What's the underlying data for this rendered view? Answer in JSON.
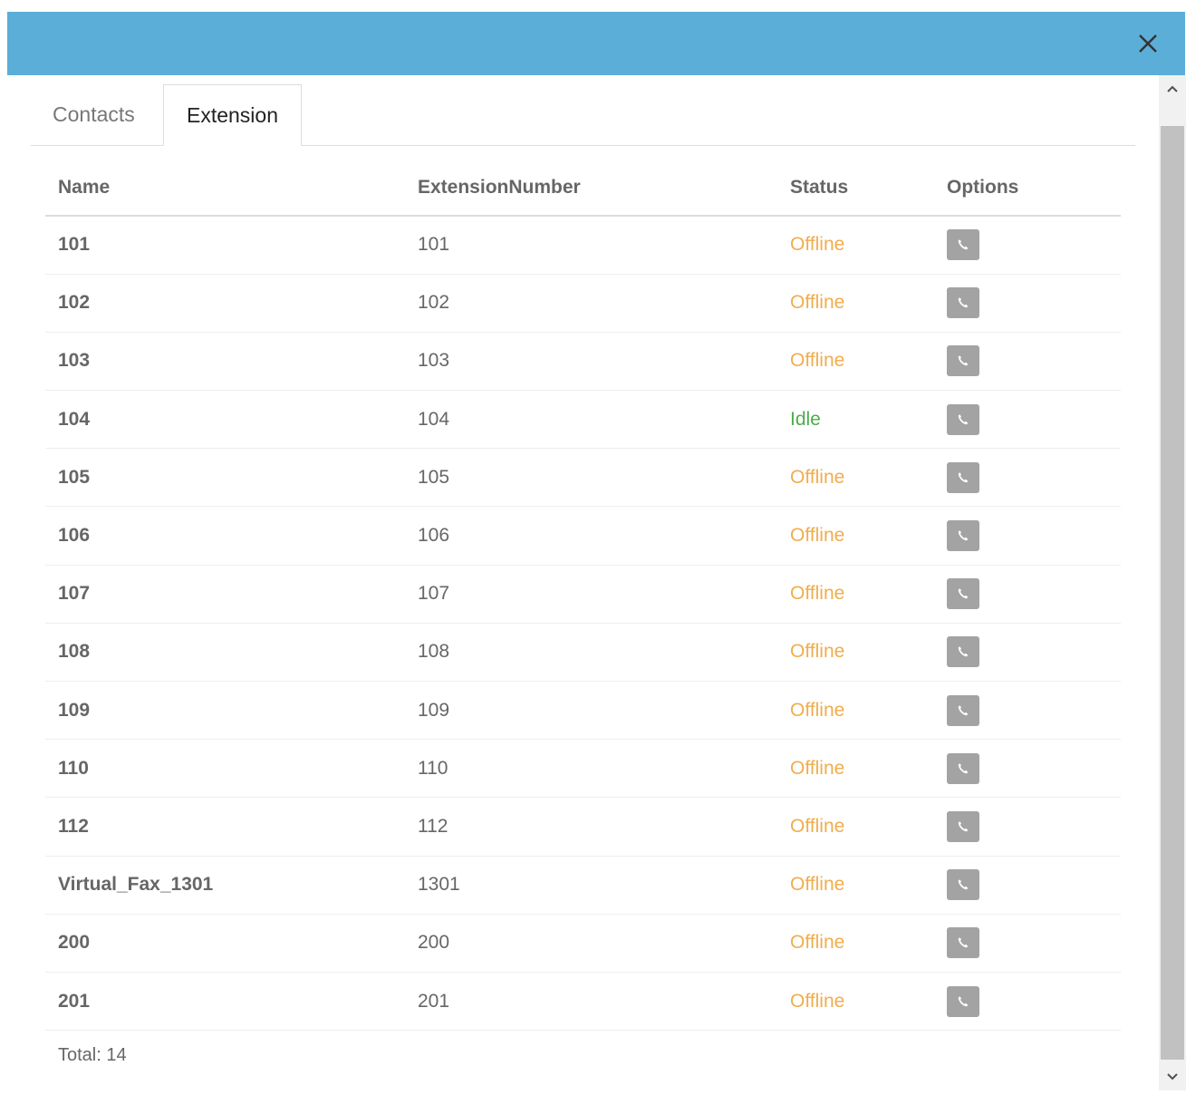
{
  "dialog": {
    "header_color": "#5baed8",
    "close_icon": "close-icon"
  },
  "tabs": [
    {
      "label": "Contacts",
      "active": false
    },
    {
      "label": "Extension",
      "active": true
    }
  ],
  "table": {
    "headers": {
      "name": "Name",
      "extension_number": "ExtensionNumber",
      "status": "Status",
      "options": "Options"
    },
    "rows": [
      {
        "name": "101",
        "extension_number": "101",
        "status": "Offline"
      },
      {
        "name": "102",
        "extension_number": "102",
        "status": "Offline"
      },
      {
        "name": "103",
        "extension_number": "103",
        "status": "Offline"
      },
      {
        "name": "104",
        "extension_number": "104",
        "status": "Idle"
      },
      {
        "name": "105",
        "extension_number": "105",
        "status": "Offline"
      },
      {
        "name": "106",
        "extension_number": "106",
        "status": "Offline"
      },
      {
        "name": "107",
        "extension_number": "107",
        "status": "Offline"
      },
      {
        "name": "108",
        "extension_number": "108",
        "status": "Offline"
      },
      {
        "name": "109",
        "extension_number": "109",
        "status": "Offline"
      },
      {
        "name": "110",
        "extension_number": "110",
        "status": "Offline"
      },
      {
        "name": "112",
        "extension_number": "112",
        "status": "Offline"
      },
      {
        "name": "Virtual_Fax_1301",
        "extension_number": "1301",
        "status": "Offline"
      },
      {
        "name": "200",
        "extension_number": "200",
        "status": "Offline"
      },
      {
        "name": "201",
        "extension_number": "201",
        "status": "Offline"
      }
    ],
    "option_icon": "phone-icon",
    "status_colors": {
      "Offline": "#f0ad4e",
      "Idle": "#4cae4c"
    }
  },
  "footer": {
    "total_label": "Total: 14"
  }
}
